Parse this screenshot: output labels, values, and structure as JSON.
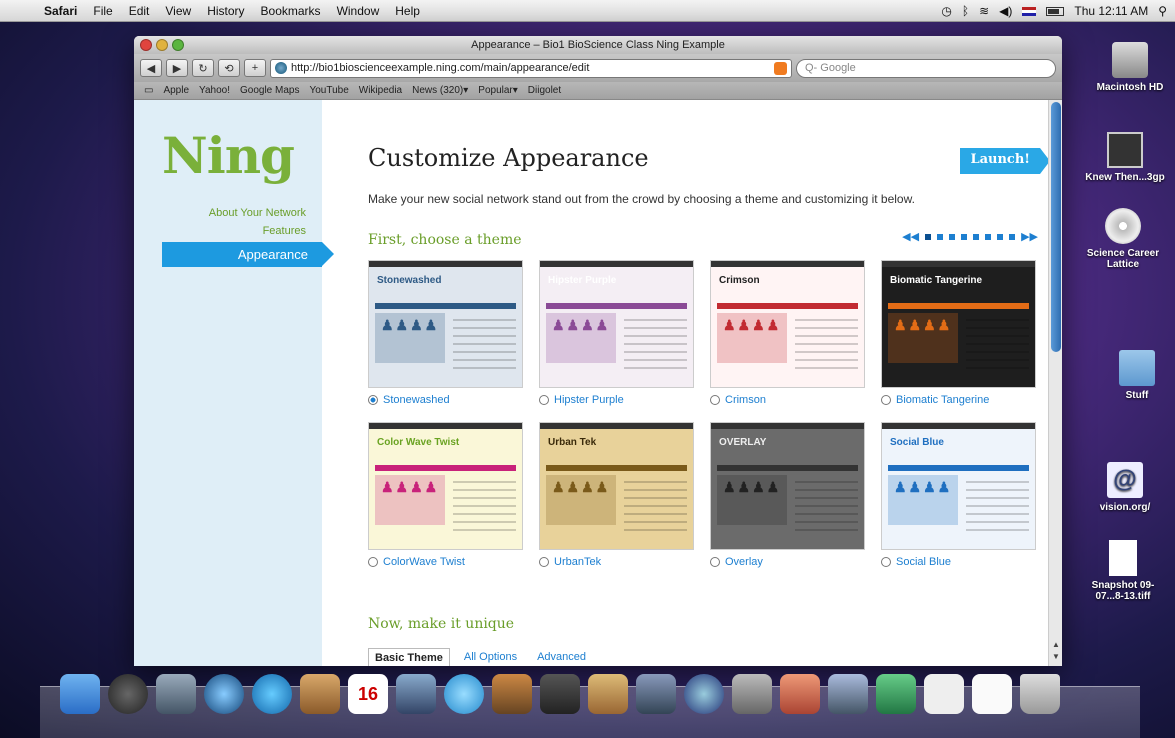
{
  "menubar": {
    "items": [
      "Safari",
      "File",
      "Edit",
      "View",
      "History",
      "Bookmarks",
      "Window",
      "Help"
    ],
    "clock": "Thu 12:11 AM"
  },
  "window": {
    "title": "Appearance – Bio1 BioScience Class Ning Example",
    "url": "http://bio1bioscienceexample.ning.com/main/appearance/edit",
    "search_placeholder": "Q- Google",
    "bookmarks": [
      "Apple",
      "Yahoo!",
      "Google Maps",
      "YouTube",
      "Wikipedia",
      "News (320)▾",
      "Popular▾",
      "Diigolet"
    ]
  },
  "sidebar": {
    "logo": "Ning",
    "nav": [
      "About Your Network",
      "Features"
    ],
    "active": "Appearance"
  },
  "main": {
    "title": "Customize Appearance",
    "launch": "Launch!",
    "subtitle": "Make your new social network stand out from the crowd by choosing a theme and customizing it below.",
    "section1": "First, choose a theme",
    "section2": "Now, make it unique",
    "themes": [
      {
        "name": "Stonewashed",
        "thumb_title": "Stonewashed",
        "bg": "#dfe6ee",
        "bar": "#2e5a85",
        "text": "#2e5a85",
        "accent": "#2e5a85"
      },
      {
        "name": "Hipster Purple",
        "thumb_title": "Hipster Purple",
        "bg": "#f4eef4",
        "bar": "#8a4a96",
        "text": "#ffffff",
        "accent": "#8a4a96"
      },
      {
        "name": "Crimson",
        "thumb_title": "Crimson",
        "bg": "#fff4f4",
        "bar": "#c22b32",
        "text": "#222222",
        "accent": "#c22b32"
      },
      {
        "name": "Biomatic Tangerine",
        "thumb_title": "Biomatic Tangerine",
        "bg": "#1e1e1e",
        "bar": "#e36c16",
        "text": "#ffffff",
        "accent": "#e36c16"
      },
      {
        "name": "ColorWave Twist",
        "thumb_title": "Color Wave Twist",
        "bg": "#faf7d8",
        "bar": "#c8227a",
        "text": "#6aa322",
        "accent": "#c8227a"
      },
      {
        "name": "UrbanTek",
        "thumb_title": "Urban Tek",
        "bg": "#e8d29a",
        "bar": "#7a5a1a",
        "text": "#3a2a0a",
        "accent": "#7a5a1a"
      },
      {
        "name": "Overlay",
        "thumb_title": "OVERLAY",
        "bg": "#6b6b6b",
        "bar": "#333333",
        "text": "#eeeeee",
        "accent": "#222222"
      },
      {
        "name": "Social Blue",
        "thumb_title": "Social Blue",
        "bg": "#eef4fb",
        "bar": "#1f6fc0",
        "text": "#1f6fc0",
        "accent": "#1f6fc0"
      }
    ],
    "tabs": [
      "Basic Theme",
      "All Options",
      "Advanced"
    ]
  },
  "desktop": {
    "icons": [
      "Macintosh HD",
      "Knew Then...3gp",
      "Science Career Lattice",
      "Stuff",
      "vision.org/",
      "Snapshot 09-07...8-13.tiff"
    ]
  },
  "dock": {
    "calendar_day": "16"
  },
  "colors": {
    "ning_green": "#7ab03a",
    "ning_blue": "#1d9ae0"
  }
}
